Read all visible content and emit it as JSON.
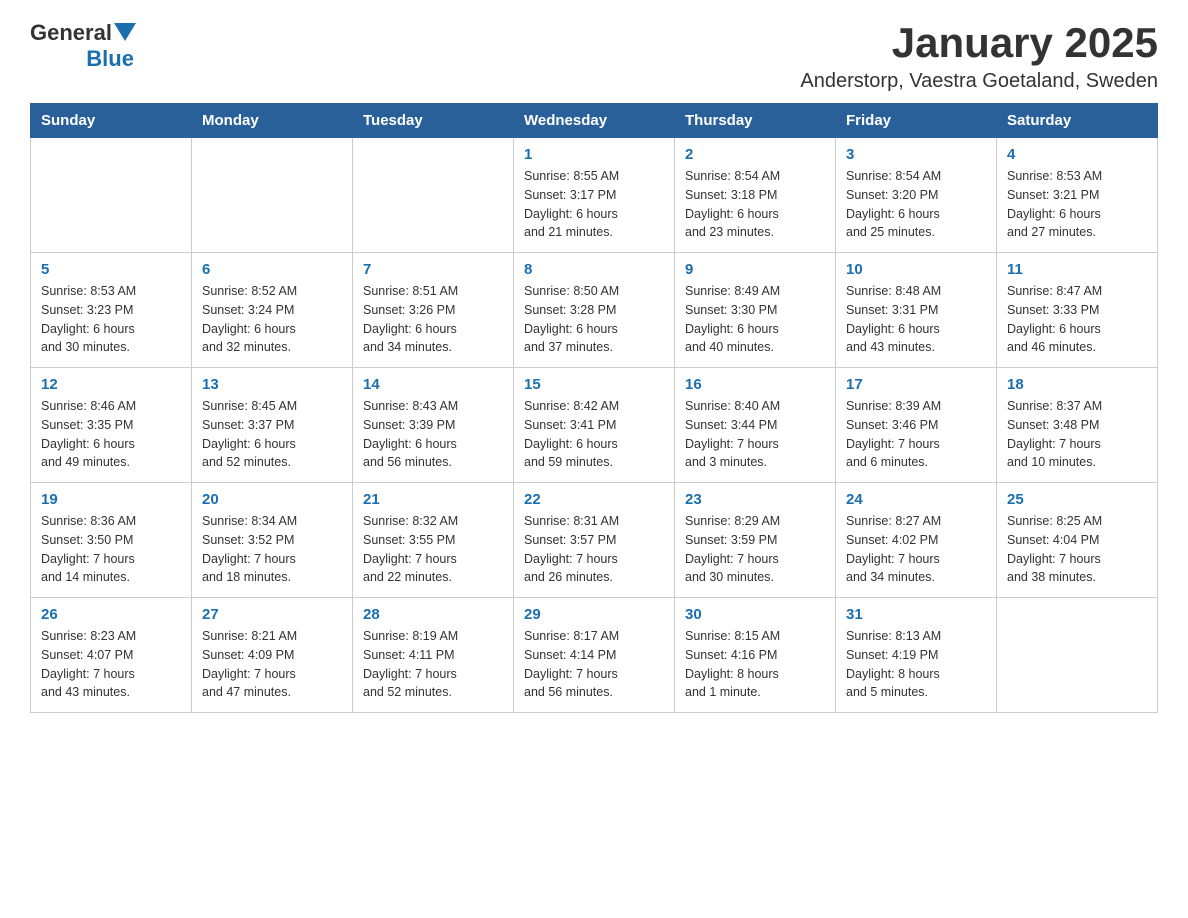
{
  "header": {
    "title": "January 2025",
    "subtitle": "Anderstorp, Vaestra Goetaland, Sweden"
  },
  "logo": {
    "general": "General",
    "blue": "Blue"
  },
  "weekdays": [
    "Sunday",
    "Monday",
    "Tuesday",
    "Wednesday",
    "Thursday",
    "Friday",
    "Saturday"
  ],
  "weeks": [
    [
      {
        "day": "",
        "info": ""
      },
      {
        "day": "",
        "info": ""
      },
      {
        "day": "",
        "info": ""
      },
      {
        "day": "1",
        "info": "Sunrise: 8:55 AM\nSunset: 3:17 PM\nDaylight: 6 hours\nand 21 minutes."
      },
      {
        "day": "2",
        "info": "Sunrise: 8:54 AM\nSunset: 3:18 PM\nDaylight: 6 hours\nand 23 minutes."
      },
      {
        "day": "3",
        "info": "Sunrise: 8:54 AM\nSunset: 3:20 PM\nDaylight: 6 hours\nand 25 minutes."
      },
      {
        "day": "4",
        "info": "Sunrise: 8:53 AM\nSunset: 3:21 PM\nDaylight: 6 hours\nand 27 minutes."
      }
    ],
    [
      {
        "day": "5",
        "info": "Sunrise: 8:53 AM\nSunset: 3:23 PM\nDaylight: 6 hours\nand 30 minutes."
      },
      {
        "day": "6",
        "info": "Sunrise: 8:52 AM\nSunset: 3:24 PM\nDaylight: 6 hours\nand 32 minutes."
      },
      {
        "day": "7",
        "info": "Sunrise: 8:51 AM\nSunset: 3:26 PM\nDaylight: 6 hours\nand 34 minutes."
      },
      {
        "day": "8",
        "info": "Sunrise: 8:50 AM\nSunset: 3:28 PM\nDaylight: 6 hours\nand 37 minutes."
      },
      {
        "day": "9",
        "info": "Sunrise: 8:49 AM\nSunset: 3:30 PM\nDaylight: 6 hours\nand 40 minutes."
      },
      {
        "day": "10",
        "info": "Sunrise: 8:48 AM\nSunset: 3:31 PM\nDaylight: 6 hours\nand 43 minutes."
      },
      {
        "day": "11",
        "info": "Sunrise: 8:47 AM\nSunset: 3:33 PM\nDaylight: 6 hours\nand 46 minutes."
      }
    ],
    [
      {
        "day": "12",
        "info": "Sunrise: 8:46 AM\nSunset: 3:35 PM\nDaylight: 6 hours\nand 49 minutes."
      },
      {
        "day": "13",
        "info": "Sunrise: 8:45 AM\nSunset: 3:37 PM\nDaylight: 6 hours\nand 52 minutes."
      },
      {
        "day": "14",
        "info": "Sunrise: 8:43 AM\nSunset: 3:39 PM\nDaylight: 6 hours\nand 56 minutes."
      },
      {
        "day": "15",
        "info": "Sunrise: 8:42 AM\nSunset: 3:41 PM\nDaylight: 6 hours\nand 59 minutes."
      },
      {
        "day": "16",
        "info": "Sunrise: 8:40 AM\nSunset: 3:44 PM\nDaylight: 7 hours\nand 3 minutes."
      },
      {
        "day": "17",
        "info": "Sunrise: 8:39 AM\nSunset: 3:46 PM\nDaylight: 7 hours\nand 6 minutes."
      },
      {
        "day": "18",
        "info": "Sunrise: 8:37 AM\nSunset: 3:48 PM\nDaylight: 7 hours\nand 10 minutes."
      }
    ],
    [
      {
        "day": "19",
        "info": "Sunrise: 8:36 AM\nSunset: 3:50 PM\nDaylight: 7 hours\nand 14 minutes."
      },
      {
        "day": "20",
        "info": "Sunrise: 8:34 AM\nSunset: 3:52 PM\nDaylight: 7 hours\nand 18 minutes."
      },
      {
        "day": "21",
        "info": "Sunrise: 8:32 AM\nSunset: 3:55 PM\nDaylight: 7 hours\nand 22 minutes."
      },
      {
        "day": "22",
        "info": "Sunrise: 8:31 AM\nSunset: 3:57 PM\nDaylight: 7 hours\nand 26 minutes."
      },
      {
        "day": "23",
        "info": "Sunrise: 8:29 AM\nSunset: 3:59 PM\nDaylight: 7 hours\nand 30 minutes."
      },
      {
        "day": "24",
        "info": "Sunrise: 8:27 AM\nSunset: 4:02 PM\nDaylight: 7 hours\nand 34 minutes."
      },
      {
        "day": "25",
        "info": "Sunrise: 8:25 AM\nSunset: 4:04 PM\nDaylight: 7 hours\nand 38 minutes."
      }
    ],
    [
      {
        "day": "26",
        "info": "Sunrise: 8:23 AM\nSunset: 4:07 PM\nDaylight: 7 hours\nand 43 minutes."
      },
      {
        "day": "27",
        "info": "Sunrise: 8:21 AM\nSunset: 4:09 PM\nDaylight: 7 hours\nand 47 minutes."
      },
      {
        "day": "28",
        "info": "Sunrise: 8:19 AM\nSunset: 4:11 PM\nDaylight: 7 hours\nand 52 minutes."
      },
      {
        "day": "29",
        "info": "Sunrise: 8:17 AM\nSunset: 4:14 PM\nDaylight: 7 hours\nand 56 minutes."
      },
      {
        "day": "30",
        "info": "Sunrise: 8:15 AM\nSunset: 4:16 PM\nDaylight: 8 hours\nand 1 minute."
      },
      {
        "day": "31",
        "info": "Sunrise: 8:13 AM\nSunset: 4:19 PM\nDaylight: 8 hours\nand 5 minutes."
      },
      {
        "day": "",
        "info": ""
      }
    ]
  ]
}
